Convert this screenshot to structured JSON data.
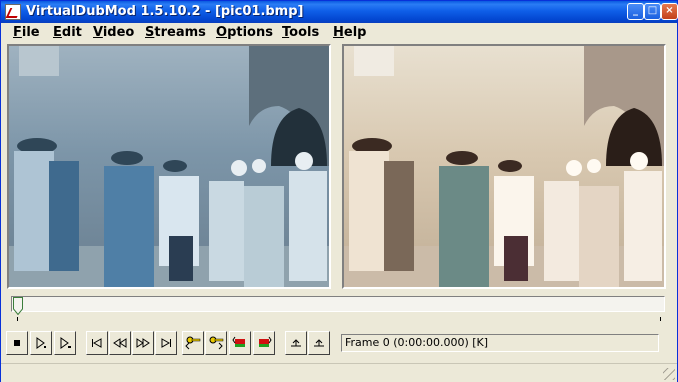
{
  "window": {
    "title": "VirtualDubMod 1.5.10.2 - [pic01.bmp]",
    "controls": {
      "minimize": "_",
      "maximize": "□",
      "close": "×"
    }
  },
  "menu": [
    "File",
    "Edit",
    "Video",
    "Streams",
    "Options",
    "Tools",
    "Help"
  ],
  "panes": {
    "input": {
      "description_icon": "input-video-preview"
    },
    "output": {
      "description_icon": "output-video-preview"
    }
  },
  "timeline": {
    "position_fraction": 0.0
  },
  "toolbar": {
    "buttons": [
      "stop-icon",
      "play-input-icon",
      "play-output-icon",
      "start-icon",
      "prev-frame-icon",
      "next-frame-icon",
      "end-icon",
      "prev-keyframe-icon",
      "next-keyframe-icon",
      "prev-scene-icon",
      "next-scene-icon",
      "mark-in-icon",
      "mark-out-icon"
    ]
  },
  "status": {
    "frame_text": "Frame 0 (0:00:00.000) [K]"
  },
  "colors": {
    "title_bar": "#0a5ae0",
    "menu_bg": "#ece9d8",
    "close": "#c3401a"
  }
}
